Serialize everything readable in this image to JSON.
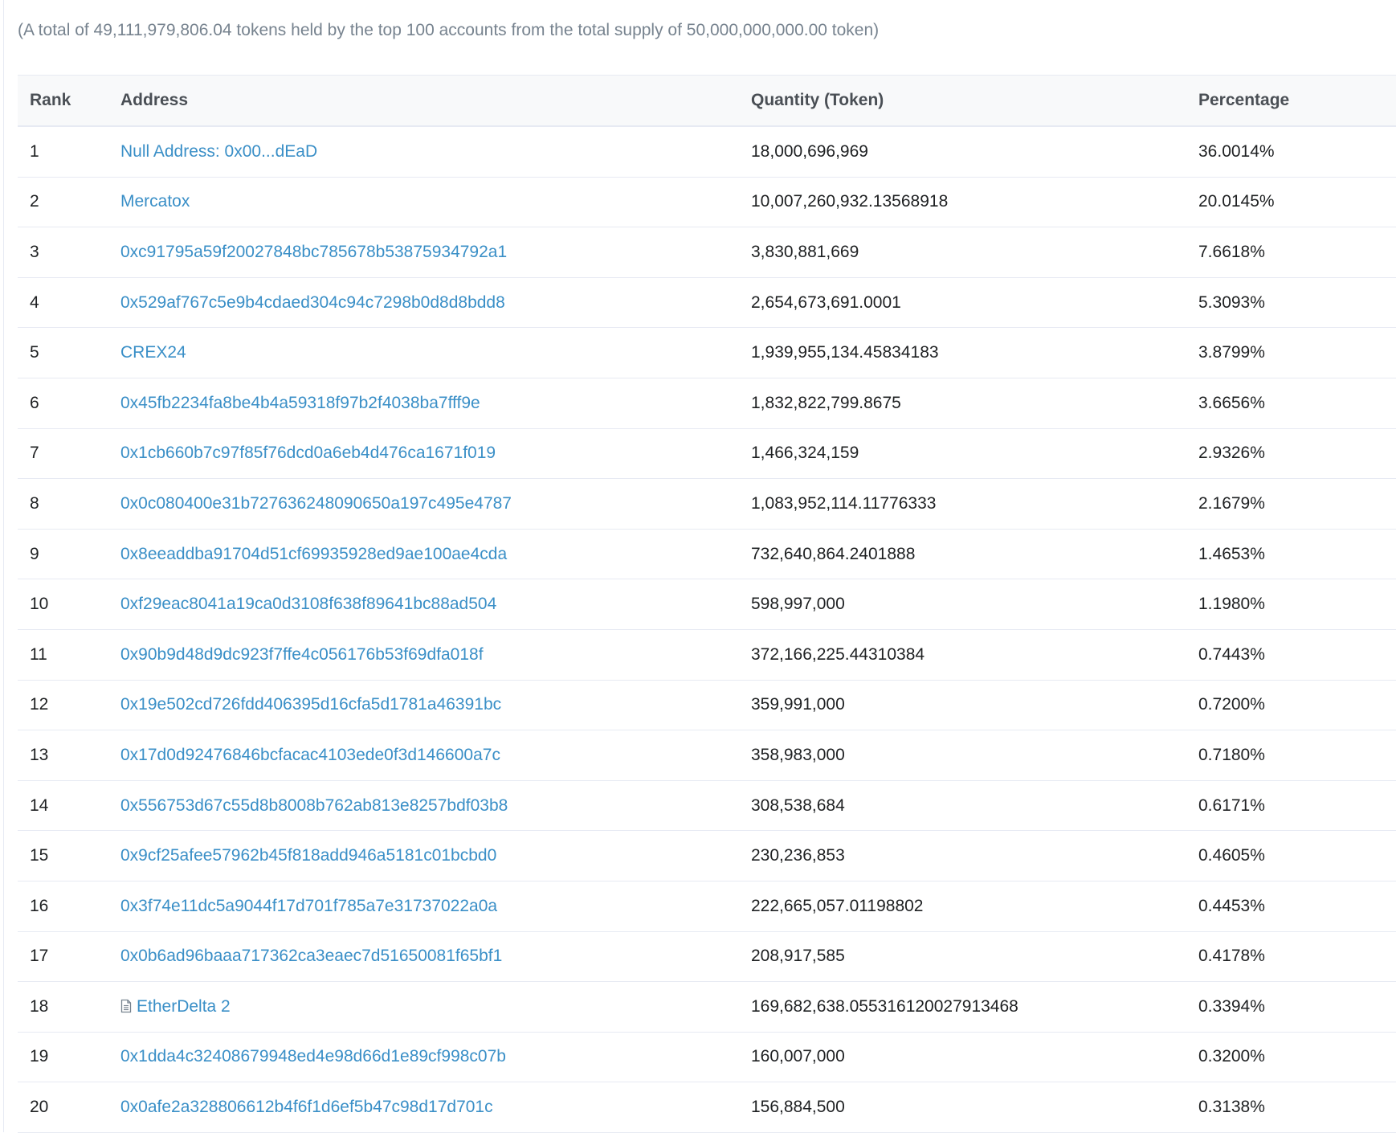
{
  "summary": "(A total of 49,111,979,806.04 tokens held by the top 100 accounts from the total supply of 50,000,000,000.00 token)",
  "table": {
    "headers": {
      "rank": "Rank",
      "address": "Address",
      "quantity": "Quantity (Token)",
      "percentage": "Percentage"
    },
    "rows": [
      {
        "rank": "1",
        "address": "Null Address: 0x00...dEaD",
        "quantity": "18,000,696,969",
        "percentage": "36.0014%",
        "contract": false
      },
      {
        "rank": "2",
        "address": "Mercatox",
        "quantity": "10,007,260,932.13568918",
        "percentage": "20.0145%",
        "contract": false
      },
      {
        "rank": "3",
        "address": "0xc91795a59f20027848bc785678b53875934792a1",
        "quantity": "3,830,881,669",
        "percentage": "7.6618%",
        "contract": false
      },
      {
        "rank": "4",
        "address": "0x529af767c5e9b4cdaed304c94c7298b0d8d8bdd8",
        "quantity": "2,654,673,691.0001",
        "percentage": "5.3093%",
        "contract": false
      },
      {
        "rank": "5",
        "address": "CREX24",
        "quantity": "1,939,955,134.45834183",
        "percentage": "3.8799%",
        "contract": false
      },
      {
        "rank": "6",
        "address": "0x45fb2234fa8be4b4a59318f97b2f4038ba7fff9e",
        "quantity": "1,832,822,799.8675",
        "percentage": "3.6656%",
        "contract": false
      },
      {
        "rank": "7",
        "address": "0x1cb660b7c97f85f76dcd0a6eb4d476ca1671f019",
        "quantity": "1,466,324,159",
        "percentage": "2.9326%",
        "contract": false
      },
      {
        "rank": "8",
        "address": "0x0c080400e31b727636248090650a197c495e4787",
        "quantity": "1,083,952,114.11776333",
        "percentage": "2.1679%",
        "contract": false
      },
      {
        "rank": "9",
        "address": "0x8eeaddba91704d51cf69935928ed9ae100ae4cda",
        "quantity": "732,640,864.2401888",
        "percentage": "1.4653%",
        "contract": false
      },
      {
        "rank": "10",
        "address": "0xf29eac8041a19ca0d3108f638f89641bc88ad504",
        "quantity": "598,997,000",
        "percentage": "1.1980%",
        "contract": false
      },
      {
        "rank": "11",
        "address": "0x90b9d48d9dc923f7ffe4c056176b53f69dfa018f",
        "quantity": "372,166,225.44310384",
        "percentage": "0.7443%",
        "contract": false
      },
      {
        "rank": "12",
        "address": "0x19e502cd726fdd406395d16cfa5d1781a46391bc",
        "quantity": "359,991,000",
        "percentage": "0.7200%",
        "contract": false
      },
      {
        "rank": "13",
        "address": "0x17d0d92476846bcfacac4103ede0f3d146600a7c",
        "quantity": "358,983,000",
        "percentage": "0.7180%",
        "contract": false
      },
      {
        "rank": "14",
        "address": "0x556753d67c55d8b8008b762ab813e8257bdf03b8",
        "quantity": "308,538,684",
        "percentage": "0.6171%",
        "contract": false
      },
      {
        "rank": "15",
        "address": "0x9cf25afee57962b45f818add946a5181c01bcbd0",
        "quantity": "230,236,853",
        "percentage": "0.4605%",
        "contract": false
      },
      {
        "rank": "16",
        "address": "0x3f74e11dc5a9044f17d701f785a7e31737022a0a",
        "quantity": "222,665,057.01198802",
        "percentage": "0.4453%",
        "contract": false
      },
      {
        "rank": "17",
        "address": "0x0b6ad96baaa717362ca3eaec7d51650081f65bf1",
        "quantity": "208,917,585",
        "percentage": "0.4178%",
        "contract": false
      },
      {
        "rank": "18",
        "address": "EtherDelta 2",
        "quantity": "169,682,638.055316120027913468",
        "percentage": "0.3394%",
        "contract": true
      },
      {
        "rank": "19",
        "address": "0x1dda4c32408679948ed4e98d66d1e89cf998c07b",
        "quantity": "160,007,000",
        "percentage": "0.3200%",
        "contract": false
      },
      {
        "rank": "20",
        "address": "0x0afe2a328806612b4f6f1d6ef5b47c98d17d701c",
        "quantity": "156,884,500",
        "percentage": "0.3138%",
        "contract": false
      }
    ]
  },
  "icons": {
    "contract": "file-contract-icon"
  },
  "colors": {
    "link": "#3a8fc7",
    "muted": "#77838f",
    "border": "#e7eaf3",
    "header_bg": "#f8f9fa"
  }
}
